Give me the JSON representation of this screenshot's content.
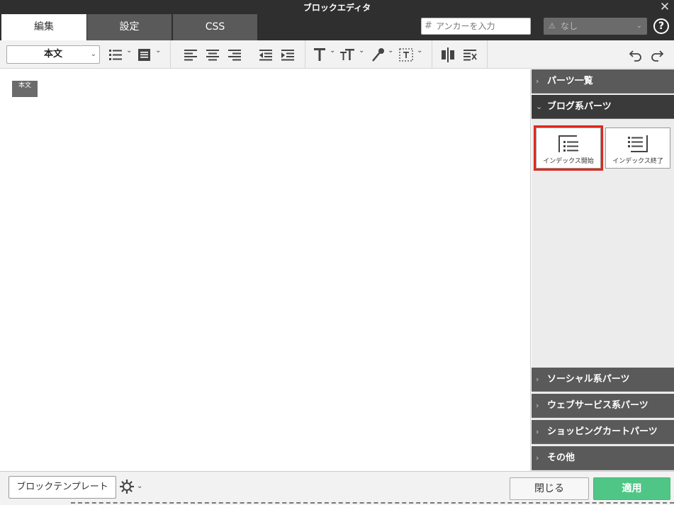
{
  "window": {
    "title": "ブロックエディタ",
    "close_glyph": "✕"
  },
  "tabs": [
    {
      "label": "編集",
      "active": true
    },
    {
      "label": "設定",
      "active": false
    },
    {
      "label": "CSS",
      "active": false
    }
  ],
  "anchor": {
    "placeholder": "アンカーを入力",
    "hash": "#"
  },
  "class_select": {
    "value": "なし"
  },
  "help": {
    "glyph": "?"
  },
  "toolbar": {
    "style_select": "本文",
    "icons": [
      "list-icon",
      "block-format-icon",
      "align-left-icon",
      "align-center-icon",
      "align-right-icon",
      "outdent-icon",
      "indent-icon",
      "text-color-icon",
      "font-size-icon",
      "eyedropper-icon",
      "text-frame-icon",
      "split-block-icon",
      "clear-format-icon",
      "undo-icon",
      "redo-icon"
    ]
  },
  "editor": {
    "block_tag": "本文"
  },
  "sidebar": {
    "sections": [
      {
        "label": "パーツ一覧",
        "open": false
      },
      {
        "label": "ブログ系パーツ",
        "open": true
      },
      {
        "label": "ソーシャル系パーツ",
        "open": false
      },
      {
        "label": "ウェブサービス系パーツ",
        "open": false
      },
      {
        "label": "ショッピングカートパーツ",
        "open": false
      },
      {
        "label": "その他",
        "open": false
      }
    ],
    "parts": [
      {
        "label": "インデックス開始",
        "selected": true
      },
      {
        "label": "インデックス終了",
        "selected": false
      }
    ]
  },
  "footer": {
    "template_button": "ブロックテンプレート",
    "close_button": "閉じる",
    "apply_button": "適用"
  },
  "colors": {
    "accent_green": "#4fc685",
    "highlight_red": "#e0281e",
    "titlebar": "#2f2f2f"
  }
}
